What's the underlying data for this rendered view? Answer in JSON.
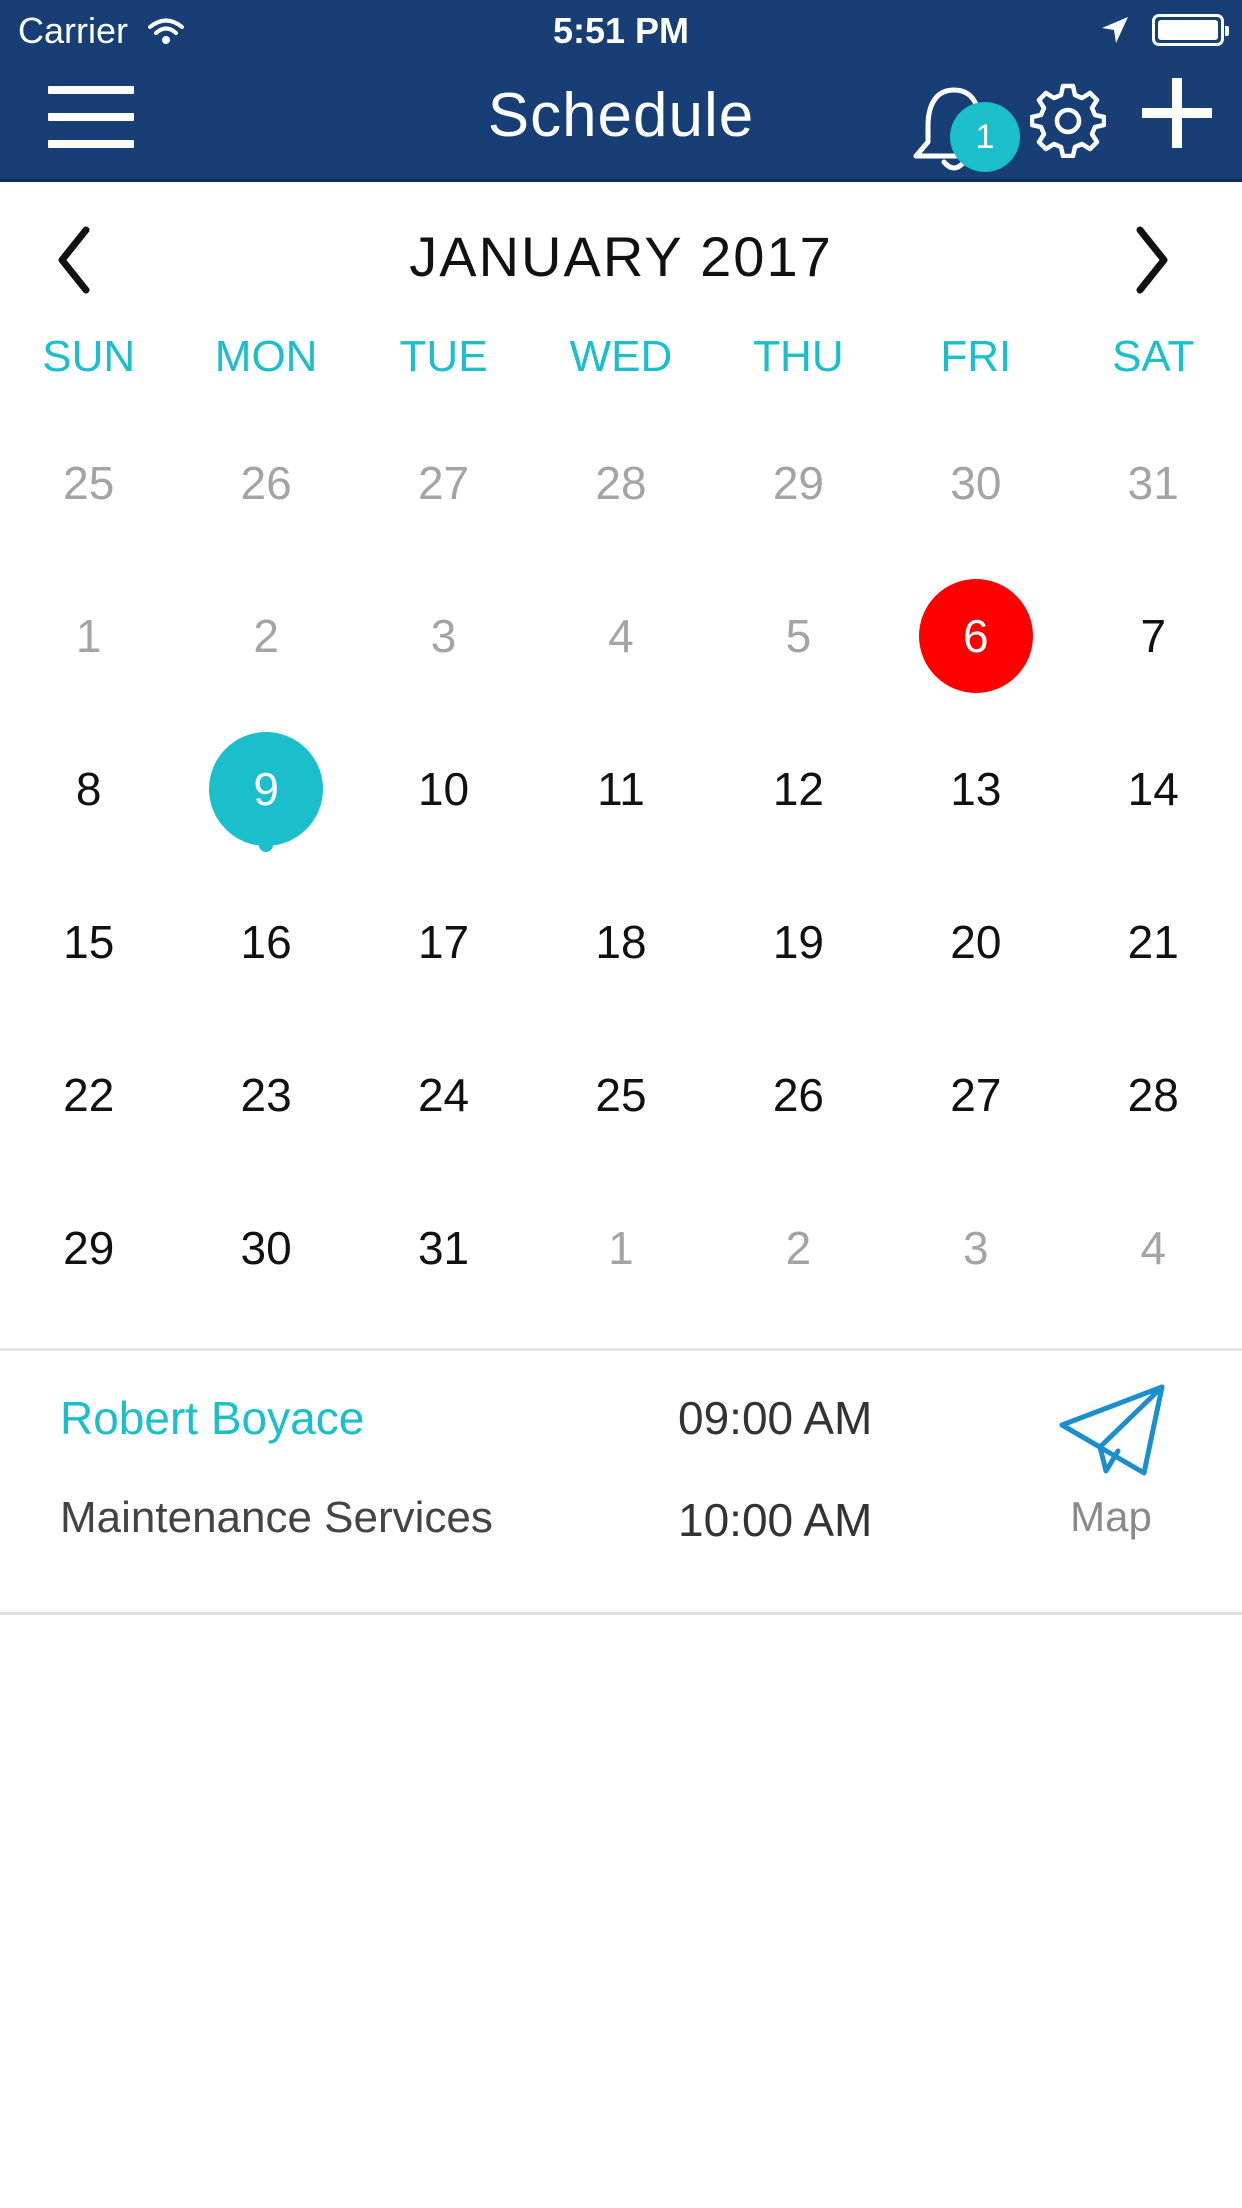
{
  "status_bar": {
    "carrier": "Carrier",
    "time": "5:51 PM",
    "icons": [
      "wifi-icon",
      "location-arrow-icon",
      "battery-icon"
    ]
  },
  "nav": {
    "title": "Schedule",
    "notification_count": "1",
    "icons": [
      "menu-icon",
      "bell-icon",
      "gear-icon",
      "plus-icon"
    ],
    "background_color": "#173e75"
  },
  "calendar": {
    "month_label": "JANUARY 2017",
    "weekdays": [
      "SUN",
      "MON",
      "TUE",
      "WED",
      "THU",
      "FRI",
      "SAT"
    ],
    "accent_color": "#1bbfcc",
    "today_color": "#ff0000",
    "weeks": [
      [
        {
          "d": "25",
          "m": true
        },
        {
          "d": "26",
          "m": true
        },
        {
          "d": "27",
          "m": true
        },
        {
          "d": "28",
          "m": true
        },
        {
          "d": "29",
          "m": true
        },
        {
          "d": "30",
          "m": true
        },
        {
          "d": "31",
          "m": true
        }
      ],
      [
        {
          "d": "1",
          "m": true
        },
        {
          "d": "2",
          "m": true
        },
        {
          "d": "3",
          "m": true
        },
        {
          "d": "4",
          "m": true
        },
        {
          "d": "5",
          "m": true
        },
        {
          "d": "6",
          "today": true
        },
        {
          "d": "7"
        }
      ],
      [
        {
          "d": "8"
        },
        {
          "d": "9",
          "selected": true,
          "has_event": true
        },
        {
          "d": "10"
        },
        {
          "d": "11"
        },
        {
          "d": "12"
        },
        {
          "d": "13"
        },
        {
          "d": "14"
        }
      ],
      [
        {
          "d": "15"
        },
        {
          "d": "16"
        },
        {
          "d": "17"
        },
        {
          "d": "18"
        },
        {
          "d": "19"
        },
        {
          "d": "20"
        },
        {
          "d": "21"
        }
      ],
      [
        {
          "d": "22"
        },
        {
          "d": "23"
        },
        {
          "d": "24"
        },
        {
          "d": "25"
        },
        {
          "d": "26"
        },
        {
          "d": "27"
        },
        {
          "d": "28"
        }
      ],
      [
        {
          "d": "29"
        },
        {
          "d": "30"
        },
        {
          "d": "31"
        },
        {
          "d": "1",
          "m": true
        },
        {
          "d": "2",
          "m": true
        },
        {
          "d": "3",
          "m": true
        },
        {
          "d": "4",
          "m": true
        }
      ]
    ]
  },
  "event": {
    "client": "Robert Boyace",
    "service": "Maintenance Services",
    "start_time": "09:00 AM",
    "end_time": "10:00 AM",
    "map_label": "Map",
    "map_icon": "paper-plane-icon"
  }
}
